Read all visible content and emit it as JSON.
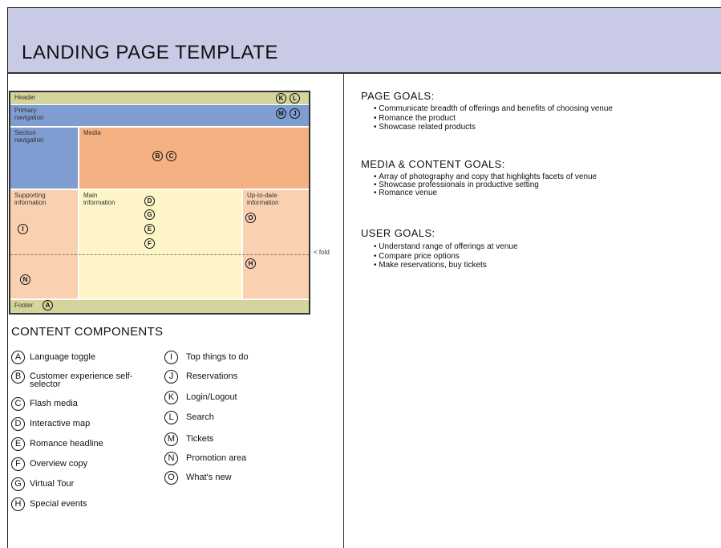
{
  "title": "LANDING PAGE TEMPLATE",
  "wireframe": {
    "zones": {
      "header": "Header",
      "primary_navigation": "Primary navigation",
      "section_navigation": "Section navigation",
      "media": "Media",
      "supporting_information": "Supporting information",
      "main_information": "Main information",
      "up_to_date_information": "Up-to-date information",
      "footer": "Footer"
    },
    "fold_label": "< fold",
    "markers": {
      "header": [
        "K",
        "L"
      ],
      "primary_navigation": [
        "M",
        "J"
      ],
      "media": [
        "B",
        "C"
      ],
      "main_information": [
        "D",
        "G",
        "E",
        "F"
      ],
      "supporting_information": [
        "I",
        "N"
      ],
      "up_to_date_information": [
        "O",
        "H"
      ],
      "footer": [
        "A"
      ]
    }
  },
  "content_components": {
    "title": "CONTENT COMPONENTS",
    "items": [
      {
        "letter": "A",
        "label": "Language toggle"
      },
      {
        "letter": "B",
        "label": "Customer experience self-selector"
      },
      {
        "letter": "C",
        "label": "Flash media"
      },
      {
        "letter": "D",
        "label": "Interactive map"
      },
      {
        "letter": "E",
        "label": "Romance headline"
      },
      {
        "letter": "F",
        "label": "Overview copy"
      },
      {
        "letter": "G",
        "label": "Virtual Tour"
      },
      {
        "letter": "H",
        "label": "Special events"
      },
      {
        "letter": "I",
        "label": "Top things to do"
      },
      {
        "letter": "J",
        "label": "Reservations"
      },
      {
        "letter": "K",
        "label": "Login/Logout"
      },
      {
        "letter": "L",
        "label": "Search"
      },
      {
        "letter": "M",
        "label": "Tickets"
      },
      {
        "letter": "N",
        "label": "Promotion area"
      },
      {
        "letter": "O",
        "label": "What's new"
      }
    ]
  },
  "goals": {
    "page": {
      "heading": "PAGE GOALS:",
      "items": [
        "Communicate breadth of offerings and benefits of choosing venue",
        "Romance the product",
        "Showcase related products"
      ]
    },
    "media_content": {
      "heading": "MEDIA & CONTENT GOALS:",
      "items": [
        "Array of photography and copy that highlights facets of venue",
        "Showcase professionals in productive setting",
        "Romance venue"
      ]
    },
    "user": {
      "heading": "USER GOALS:",
      "items": [
        "Understand range of offerings at venue",
        "Compare price options",
        "Make reservations, buy tickets"
      ]
    }
  },
  "colors": {
    "banner": "#c8cae6",
    "header_footer": "#d4d49c",
    "navigation": "#7f9dd0",
    "media": "#f5b184",
    "side_info": "#f9d1b0",
    "main_info": "#fdf4c8"
  }
}
